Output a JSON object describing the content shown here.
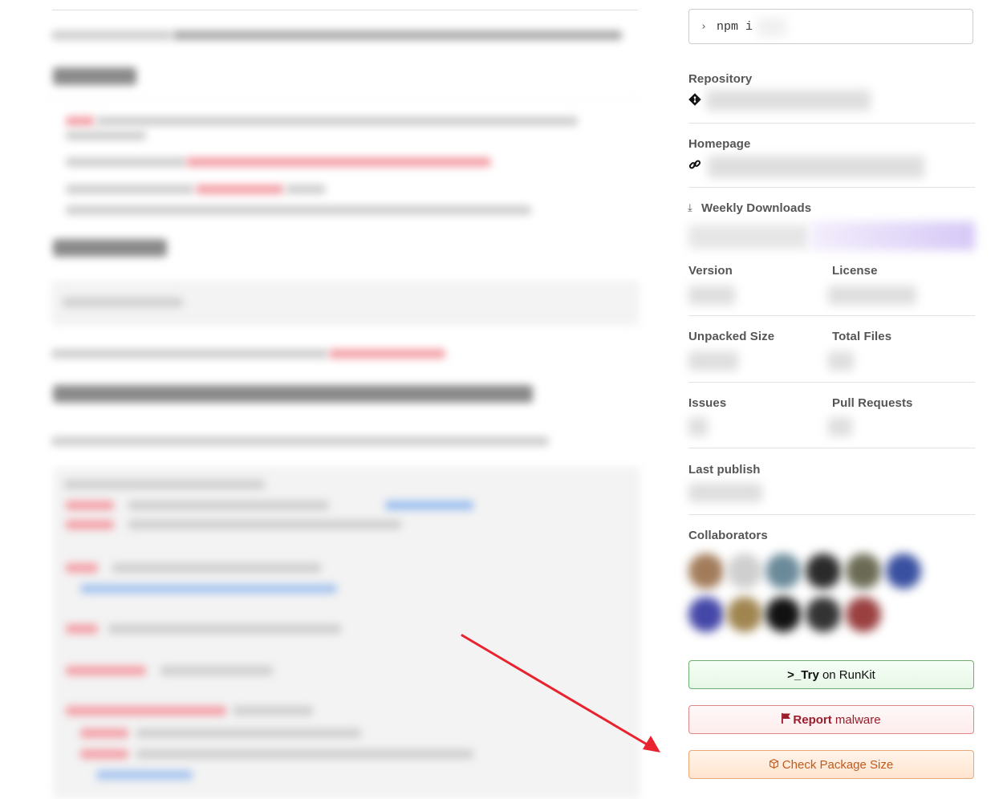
{
  "install": {
    "prompt_icon": "chevron-right-icon",
    "command": "npm i"
  },
  "repository": {
    "label": "Repository",
    "icon": "git-icon"
  },
  "homepage": {
    "label": "Homepage",
    "icon": "link-icon"
  },
  "weekly_downloads": {
    "label": "Weekly Downloads",
    "icon": "download-icon"
  },
  "version": {
    "label": "Version"
  },
  "license": {
    "label": "License"
  },
  "unpacked_size": {
    "label": "Unpacked Size"
  },
  "total_files": {
    "label": "Total Files"
  },
  "issues": {
    "label": "Issues"
  },
  "pull_requests": {
    "label": "Pull Requests"
  },
  "last_publish": {
    "label": "Last publish"
  },
  "collaborators": {
    "label": "Collaborators"
  },
  "buttons": {
    "runkit": {
      "icon": ">_",
      "bold": "Try",
      "rest": " on RunKit"
    },
    "malware": {
      "icon": "flag-icon",
      "bold": "Report",
      "rest": " malware"
    },
    "package_size": {
      "icon": "package-icon",
      "text": "Check Package Size"
    }
  },
  "colors": {
    "arrow": "#e8232f",
    "runkit_border": "#6fae6f",
    "malware_text": "#9b1c2a",
    "size_text": "#c25a1c"
  }
}
